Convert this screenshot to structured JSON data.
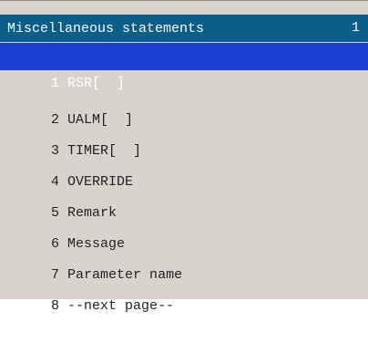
{
  "menu": {
    "title": "Miscellaneous statements",
    "page": "1",
    "items": [
      {
        "num": "1",
        "label": "RSR[  ]",
        "selected": true
      },
      {
        "num": "2",
        "label": "UALM[  ]",
        "selected": false
      },
      {
        "num": "3",
        "label": "TIMER[  ]",
        "selected": false
      },
      {
        "num": "4",
        "label": "OVERRIDE",
        "selected": false
      },
      {
        "num": "5",
        "label": "Remark",
        "selected": false
      },
      {
        "num": "6",
        "label": "Message",
        "selected": false
      },
      {
        "num": "7",
        "label": "Parameter name",
        "selected": false
      },
      {
        "num": "8",
        "label": "--next page--",
        "selected": false
      }
    ]
  },
  "colors": {
    "title_bg": "#0b5d8a",
    "selected_bg": "#1b3fd1",
    "menu_bg": "#d8d4cc"
  }
}
